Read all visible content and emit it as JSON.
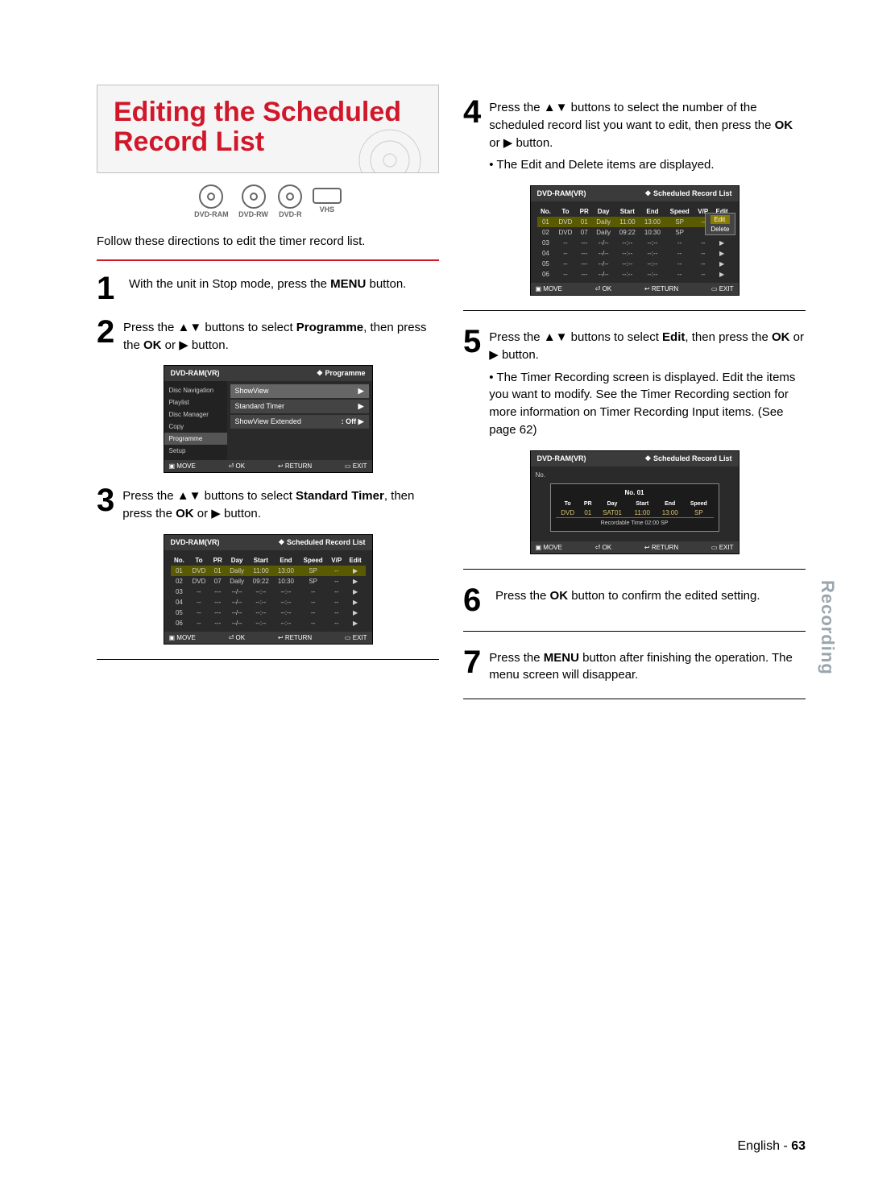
{
  "title": "Editing the Scheduled Record List",
  "media": [
    "DVD-RAM",
    "DVD-RW",
    "DVD-R",
    "VHS"
  ],
  "intro": "Follow these directions to edit the timer record list.",
  "steps": {
    "s1": "With the unit in Stop mode, press the ",
    "s1b": "MENU",
    "s1c": " button.",
    "s2": "Press the ▲▼ buttons to select ",
    "s2b": "Programme",
    "s2c": ", then press the ",
    "s2d": "OK",
    "s2e": " or ▶ button.",
    "s3": "Press the ▲▼ buttons to select ",
    "s3b": "Standard Timer",
    "s3c": ", then press the ",
    "s3d": "OK",
    "s3e": " or ▶ button.",
    "s4": "Press the ▲▼ buttons to select the number of the scheduled record list you want to edit, then press the ",
    "s4b": "OK",
    "s4c": " or ▶ button.",
    "s4bul": "The Edit and Delete items are displayed.",
    "s5": "Press the ▲▼ buttons to select ",
    "s5b": "Edit",
    "s5c": ", then press the ",
    "s5d": "OK",
    "s5e": " or ▶ button.",
    "s5bul1": "The Timer Recording screen is displayed. Edit the items you want to modify. See the Timer Recording section for more information on Timer Recording Input items. (See page 62)",
    "s6a": "Press the ",
    "s6b": "OK",
    "s6c": " button to confirm the edited setting.",
    "s7a": "Press the ",
    "s7b": "MENU",
    "s7c": " button after finishing the operation. The menu screen will disappear."
  },
  "screen_header": "DVD-RAM(VR)",
  "programme_label": "❖  Programme",
  "srl_label": "❖  Scheduled Record List",
  "nav_items": [
    "Disc Navigation",
    "Playlist",
    "Disc Manager",
    "Copy",
    "Programme",
    "Setup"
  ],
  "prog_opts": [
    {
      "l": "ShowView",
      "r": "▶"
    },
    {
      "l": "Standard Timer",
      "r": "▶"
    },
    {
      "l": "ShowView Extended",
      "r": ": Off        ▶"
    }
  ],
  "table_headers": [
    "No.",
    "To",
    "PR",
    "Day",
    "Start",
    "End",
    "Speed",
    "V/P",
    "Edit"
  ],
  "table_rows": [
    [
      "01",
      "DVD",
      "01",
      "Daily",
      "11:00",
      "13:00",
      "SP",
      "--",
      "▶"
    ],
    [
      "02",
      "DVD",
      "07",
      "Daily",
      "09:22",
      "10:30",
      "SP",
      "--",
      "▶"
    ],
    [
      "03",
      "--",
      "---",
      "--/--",
      "--:--",
      "--:--",
      "--",
      "--",
      "▶"
    ],
    [
      "04",
      "--",
      "---",
      "--/--",
      "--:--",
      "--:--",
      "--",
      "--",
      "▶"
    ],
    [
      "05",
      "--",
      "---",
      "--/--",
      "--:--",
      "--:--",
      "--",
      "--",
      "▶"
    ],
    [
      "06",
      "--",
      "---",
      "--/--",
      "--:--",
      "--:--",
      "--",
      "--",
      "▶"
    ]
  ],
  "popup_items": [
    "Edit",
    "Delete"
  ],
  "edit_box": {
    "title": "No. 01",
    "headers": [
      "To",
      "PR",
      "Day",
      "Start",
      "End",
      "Speed"
    ],
    "values": [
      "DVD",
      "01",
      "SAT01",
      "11:00",
      "13:00",
      "SP"
    ],
    "rec": "Recordable Time 02:00 SP"
  },
  "hints": {
    "move": "MOVE",
    "ok": "OK",
    "return": "RETURN",
    "exit": "EXIT"
  },
  "side_tab": "Recording",
  "footer_lang": "English - ",
  "footer_page": "63"
}
